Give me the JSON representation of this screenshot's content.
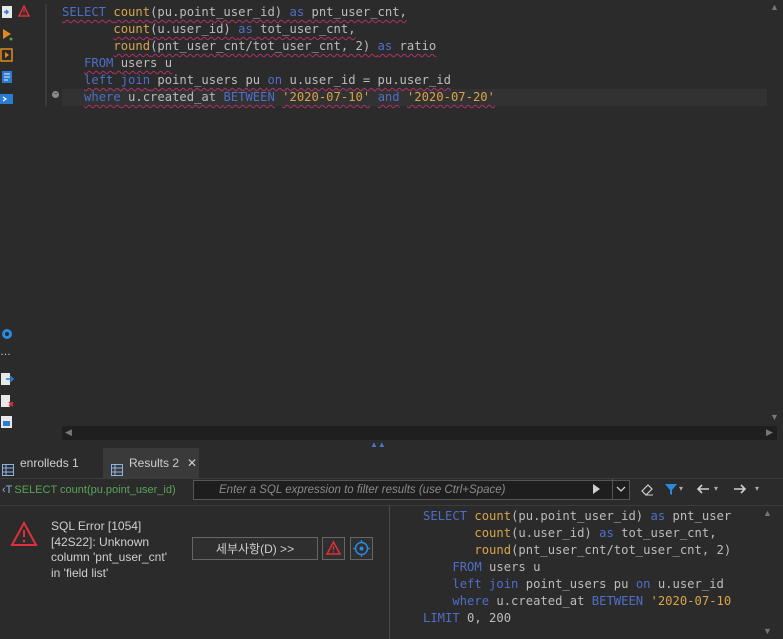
{
  "editor": {
    "lines": [
      [
        {
          "t": "SELECT ",
          "c": "kw"
        },
        {
          "t": "count",
          "c": "fn"
        },
        {
          "t": "(pu.point_user_id) ",
          "c": "id"
        },
        {
          "t": "as",
          "c": "kw"
        },
        {
          "t": " pnt_user_cnt,",
          "c": "id"
        }
      ],
      [
        {
          "t": "       ",
          "c": "id"
        },
        {
          "t": "count",
          "c": "fn"
        },
        {
          "t": "(u.user_id) ",
          "c": "id"
        },
        {
          "t": "as",
          "c": "kw"
        },
        {
          "t": " tot_user_cnt,",
          "c": "id"
        }
      ],
      [
        {
          "t": "       ",
          "c": "id"
        },
        {
          "t": "round",
          "c": "fn"
        },
        {
          "t": "(pnt_user_cnt/tot_user_cnt, 2) ",
          "c": "id"
        },
        {
          "t": "as",
          "c": "kw"
        },
        {
          "t": " ratio",
          "c": "id"
        }
      ],
      [
        {
          "t": "   ",
          "c": "id"
        },
        {
          "t": "FROM",
          "c": "kw"
        },
        {
          "t": " users u",
          "c": "id"
        }
      ],
      [
        {
          "t": "   ",
          "c": "id"
        },
        {
          "t": "left join",
          "c": "kw"
        },
        {
          "t": " point_users pu ",
          "c": "id"
        },
        {
          "t": "on",
          "c": "kw"
        },
        {
          "t": " u.user_id = pu.user_id",
          "c": "id"
        }
      ],
      [
        {
          "t": "   ",
          "c": "id"
        },
        {
          "t": "where",
          "c": "kw"
        },
        {
          "t": " u.created_at ",
          "c": "id"
        },
        {
          "t": "BETWEEN",
          "c": "kw"
        },
        {
          "t": " ",
          "c": "id"
        },
        {
          "t": "'2020-07-10'",
          "c": "str"
        },
        {
          "t": " ",
          "c": "id"
        },
        {
          "t": "and",
          "c": "kw"
        },
        {
          "t": " ",
          "c": "id"
        },
        {
          "t": "'2020-07-20'",
          "c": "str"
        }
      ]
    ],
    "squiggly_lines": [
      0,
      1,
      2,
      3,
      4,
      5
    ],
    "current_line": 5
  },
  "tabs": {
    "tab1_label": "enrolleds 1",
    "tab2_label": "Results 2",
    "tab2_close": "✕"
  },
  "filter": {
    "query_label": "SELECT count(pu.point_user_id)",
    "placeholder": "Enter a SQL expression to filter results (use Ctrl+Space)"
  },
  "error": {
    "title": "SQL Error [1054]",
    "line2": "[42S22]: Unknown",
    "line3": "column 'pnt_user_cnt'",
    "line4": "in 'field list'",
    "details_button": "세부사항(D) >>"
  },
  "result_sql": {
    "lines": [
      [
        {
          "t": "SELECT ",
          "c": "kw"
        },
        {
          "t": "count",
          "c": "fn"
        },
        {
          "t": "(pu.point_user_id) ",
          "c": "id"
        },
        {
          "t": "as",
          "c": "kw"
        },
        {
          "t": " pnt_user",
          "c": "id"
        }
      ],
      [
        {
          "t": "       ",
          "c": "id"
        },
        {
          "t": "count",
          "c": "fn"
        },
        {
          "t": "(u.user_id) ",
          "c": "id"
        },
        {
          "t": "as",
          "c": "kw"
        },
        {
          "t": " tot_user_cnt,",
          "c": "id"
        }
      ],
      [
        {
          "t": "       ",
          "c": "id"
        },
        {
          "t": "round",
          "c": "fn"
        },
        {
          "t": "(pnt_user_cnt/tot_user_cnt, 2)",
          "c": "id"
        }
      ],
      [
        {
          "t": "    ",
          "c": "id"
        },
        {
          "t": "FROM",
          "c": "kw"
        },
        {
          "t": " users u",
          "c": "id"
        }
      ],
      [
        {
          "t": "    ",
          "c": "id"
        },
        {
          "t": "left join",
          "c": "kw"
        },
        {
          "t": " point_users pu ",
          "c": "id"
        },
        {
          "t": "on",
          "c": "kw"
        },
        {
          "t": " u.user_id",
          "c": "id"
        }
      ],
      [
        {
          "t": "    ",
          "c": "id"
        },
        {
          "t": "where",
          "c": "kw"
        },
        {
          "t": " u.created_at ",
          "c": "id"
        },
        {
          "t": "BETWEEN",
          "c": "kw"
        },
        {
          "t": " ",
          "c": "id"
        },
        {
          "t": "'2020-07-10",
          "c": "str"
        }
      ],
      [
        {
          "t": "LIMIT",
          "c": "kw"
        },
        {
          "t": " 0, 200",
          "c": "id"
        }
      ]
    ]
  },
  "colors": {
    "background": "#2b2b2b",
    "keyword": "#4f6ec8",
    "function": "#d8a54a",
    "string": "#d8a54a",
    "error_red": "#e0303a",
    "filter_query_green": "#5aa35a"
  }
}
